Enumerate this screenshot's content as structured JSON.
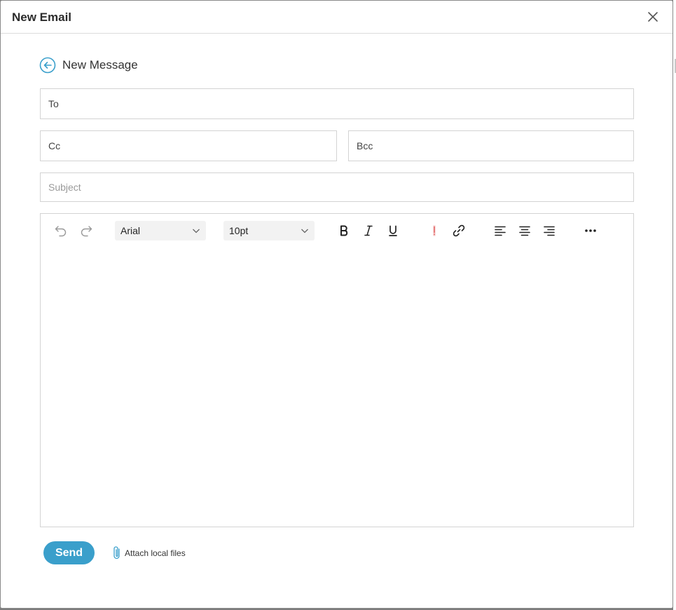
{
  "dialog": {
    "title": "New Email",
    "heading": "New Message"
  },
  "fields": {
    "to_label": "To",
    "cc_label": "Cc",
    "bcc_label": "Bcc",
    "subject_placeholder": "Subject"
  },
  "toolbar": {
    "font_family": "Arial",
    "font_size": "10pt",
    "icons": [
      "undo-icon",
      "redo-icon",
      "bold-icon",
      "italic-icon",
      "underline-icon",
      "text-color-icon",
      "link-icon",
      "align-left-icon",
      "align-center-icon",
      "align-right-icon",
      "more-icon"
    ]
  },
  "footer": {
    "send_label": "Send",
    "attach_label": "Attach local files"
  },
  "colors": {
    "accent": "#3a9fcb",
    "text_color_indicator": "#e26a6a"
  }
}
